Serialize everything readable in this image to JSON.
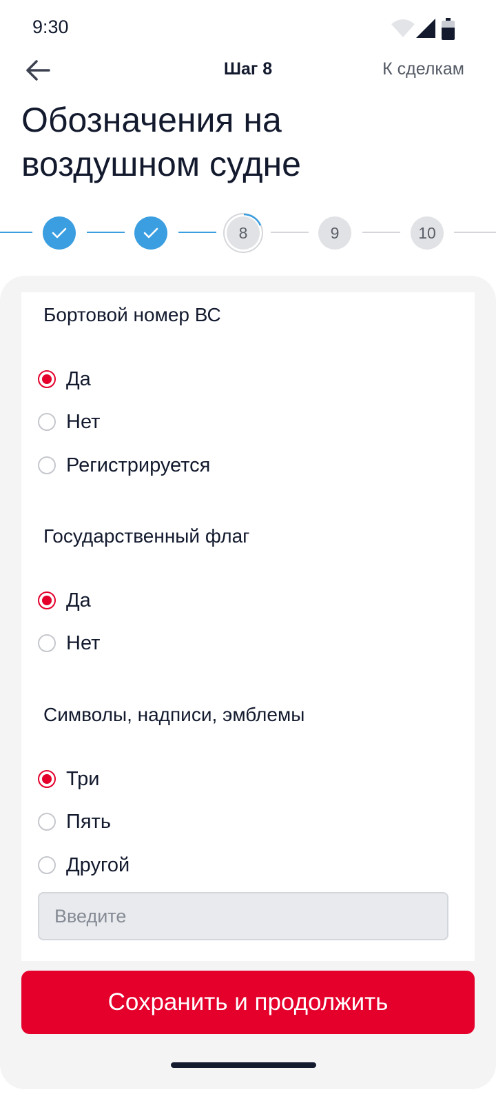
{
  "status_bar": {
    "time": "9:30",
    "icons": [
      "wifi-icon",
      "signal-icon",
      "battery-icon"
    ]
  },
  "header": {
    "back_icon": "arrow-left-icon",
    "step_label": "Шаг 8",
    "deals_link": "К сделкам"
  },
  "page_title": "Обозначения на воздушном судне",
  "stepper": {
    "steps": [
      {
        "label": "",
        "state": "done"
      },
      {
        "label": "",
        "state": "done"
      },
      {
        "label": "8",
        "state": "current"
      },
      {
        "label": "9",
        "state": "todo"
      },
      {
        "label": "10",
        "state": "todo"
      }
    ]
  },
  "form": {
    "sections": [
      {
        "title": "Бортовой номер ВС",
        "options": [
          "Да",
          "Нет",
          "Регистрируется"
        ],
        "selected": "Да"
      },
      {
        "title": "Государственный флаг",
        "options": [
          "Да",
          "Нет"
        ],
        "selected": "Да"
      },
      {
        "title": "Символы, надписи, эмблемы",
        "options": [
          "Три",
          "Пять",
          "Другой"
        ],
        "selected": "Три"
      }
    ],
    "other_input": {
      "value": "",
      "placeholder": "Введите"
    }
  },
  "save_button": "Сохранить и продолжить",
  "colors": {
    "accent": "#e4002b",
    "step_done": "#3a9ee0",
    "text": "#131a2e"
  }
}
